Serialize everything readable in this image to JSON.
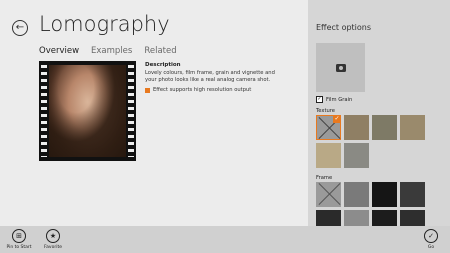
{
  "header": {
    "title": "Lomography",
    "tabs": [
      "Overview",
      "Examples",
      "Related"
    ]
  },
  "description": {
    "heading": "Description",
    "text": "Lovely colours, film frame, grain and vignette and your photo looks like a real analog camera shot.",
    "hires_note": "Effect supports high resolution output"
  },
  "panel": {
    "title": "Effect options",
    "film_grain_label": "Film Grain",
    "film_grain_checked": true,
    "texture_label": "Texture",
    "frame_label": "Frame"
  },
  "appbar": {
    "pin_label": "Pin to Start",
    "favorite_label": "Favorite",
    "go_label": "Go"
  },
  "icons": {
    "back": "back-arrow-icon",
    "pin": "pin-icon",
    "favorite": "star-icon",
    "go": "checkmark-icon",
    "camera": "camera-icon"
  },
  "colors": {
    "accent": "#e8791f",
    "panel_bg": "#d6d6d6",
    "main_bg": "#ececec"
  }
}
